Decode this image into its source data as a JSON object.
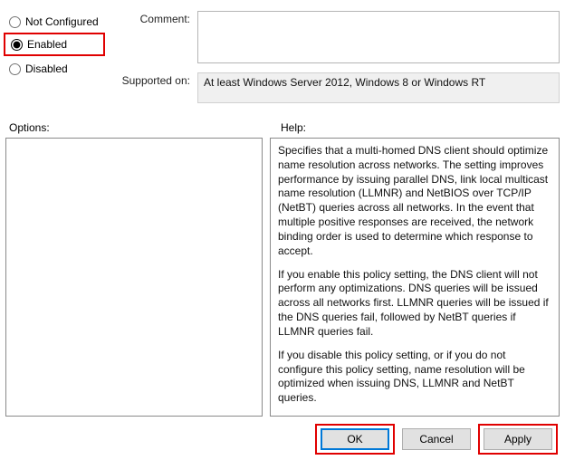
{
  "radios": {
    "not_configured": "Not Configured",
    "enabled": "Enabled",
    "disabled": "Disabled",
    "selected": "enabled"
  },
  "fields": {
    "comment_label": "Comment:",
    "comment_value": "",
    "supported_label": "Supported on:",
    "supported_value": "At least Windows Server 2012, Windows 8 or Windows RT"
  },
  "sections": {
    "options_label": "Options:",
    "help_label": "Help:"
  },
  "help": {
    "p1": "Specifies that a multi-homed DNS client should optimize name resolution across networks.  The setting improves performance by issuing parallel DNS, link local multicast name resolution (LLMNR) and NetBIOS over TCP/IP (NetBT) queries across all networks. In the event that multiple positive responses are received, the network binding order is used to determine which response to accept.",
    "p2": "If you enable this policy setting, the DNS client will not perform any optimizations.  DNS queries will be issued across all networks first. LLMNR queries will be issued if the DNS queries fail, followed by NetBT queries if LLMNR queries fail.",
    "p3": "If you disable this policy setting, or if you do not configure this policy setting, name resolution will be optimized when issuing DNS, LLMNR and NetBT queries."
  },
  "buttons": {
    "ok": "OK",
    "cancel": "Cancel",
    "apply": "Apply"
  }
}
